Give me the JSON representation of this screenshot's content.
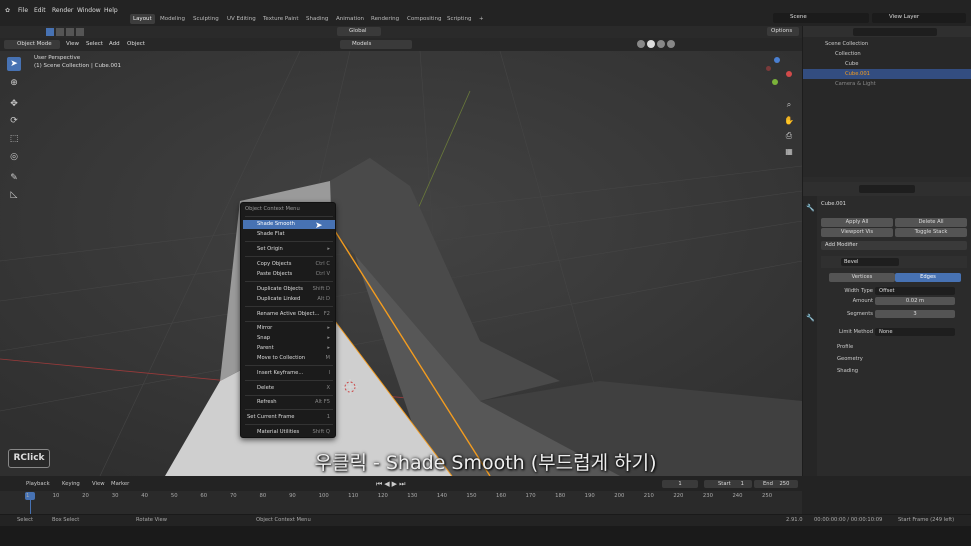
{
  "topmenu": {
    "file": "File",
    "edit": "Edit",
    "render": "Render",
    "window": "Window",
    "help": "Help"
  },
  "workspaces": [
    "Layout",
    "Modeling",
    "Sculpting",
    "UV Editing",
    "Texture Paint",
    "Shading",
    "Animation",
    "Rendering",
    "Compositing",
    "Scripting"
  ],
  "scene": {
    "name": "Scene",
    "view_layer": "View Layer"
  },
  "header": {
    "mode": "Object Mode",
    "view": "View",
    "select": "Select",
    "add": "Add",
    "object": "Object",
    "orientation": "Global",
    "collection": "Models",
    "options": "Options"
  },
  "viewport": {
    "perspective": "User Perspective",
    "collection_info": "(1) Scene Collection | Cube.001"
  },
  "context_menu": {
    "title": "Object Context Menu",
    "items": [
      {
        "label": "Shade Smooth",
        "shortcut": ""
      },
      {
        "label": "Shade Flat",
        "shortcut": ""
      },
      {
        "label": "Set Origin",
        "shortcut": "▸"
      },
      {
        "label": "Copy Objects",
        "shortcut": "Ctrl C"
      },
      {
        "label": "Paste Objects",
        "shortcut": "Ctrl V"
      },
      {
        "label": "Duplicate Objects",
        "shortcut": "Shift D"
      },
      {
        "label": "Duplicate Linked",
        "shortcut": "Alt D"
      },
      {
        "label": "Rename Active Object...",
        "shortcut": "F2"
      },
      {
        "label": "Mirror",
        "shortcut": "▸"
      },
      {
        "label": "Snap",
        "shortcut": "▸"
      },
      {
        "label": "Parent",
        "shortcut": "▸"
      },
      {
        "label": "Move to Collection",
        "shortcut": "M"
      },
      {
        "label": "Insert Keyframe...",
        "shortcut": "I"
      },
      {
        "label": "Delete",
        "shortcut": "X"
      },
      {
        "label": "Refresh",
        "shortcut": "Alt F5"
      },
      {
        "label": "Set Current Frame",
        "shortcut": "1"
      },
      {
        "label": "Material Utilities",
        "shortcut": "Shift Q"
      }
    ]
  },
  "outliner": {
    "items": [
      "Scene Collection",
      "Collection",
      "Cube",
      "Cube.001",
      "Camera & Light"
    ]
  },
  "properties": {
    "object_name": "Cube.001",
    "apply_all": "Apply All",
    "delete_all": "Delete All",
    "viewport_vis": "Viewport Vis",
    "toggle_stack": "Toggle Stack",
    "add_modifier": "Add Modifier",
    "modifier_name": "Bevel",
    "vertices": "Vertices",
    "edges": "Edges",
    "width_type_label": "Width Type",
    "width_type": "Offset",
    "amount_label": "Amount",
    "amount": "0.02 m",
    "segments_label": "Segments",
    "segments": "3",
    "limit_method_label": "Limit Method",
    "limit_method": "None",
    "profile": "Profile",
    "geometry": "Geometry",
    "shading": "Shading"
  },
  "timeline": {
    "playback": "Playback",
    "keying": "Keying",
    "view": "View",
    "marker": "Marker",
    "current_frame": "1",
    "start_label": "Start",
    "start": "1",
    "end_label": "End",
    "end": "250",
    "ticks": [
      "1",
      "10",
      "20",
      "30",
      "40",
      "50",
      "60",
      "70",
      "80",
      "90",
      "100",
      "110",
      "120",
      "130",
      "140",
      "150",
      "160",
      "170",
      "180",
      "190",
      "200",
      "210",
      "220",
      "230",
      "240",
      "250"
    ]
  },
  "status": {
    "select": "Select",
    "box_select": "Box Select",
    "rotate_view": "Rotate View",
    "context": "Object Context Menu",
    "version": "2.91.0",
    "time": "00:00:00:00 / 00:00:10:09",
    "frames": "Start Frame (249 left)"
  },
  "overlay": {
    "rclick": "RClick",
    "subtitle": "우클릭 - Shade Smooth (부드럽게 하기)"
  },
  "colors": {
    "accent": "#4772b3",
    "selection_orange": "#f39c1f"
  }
}
